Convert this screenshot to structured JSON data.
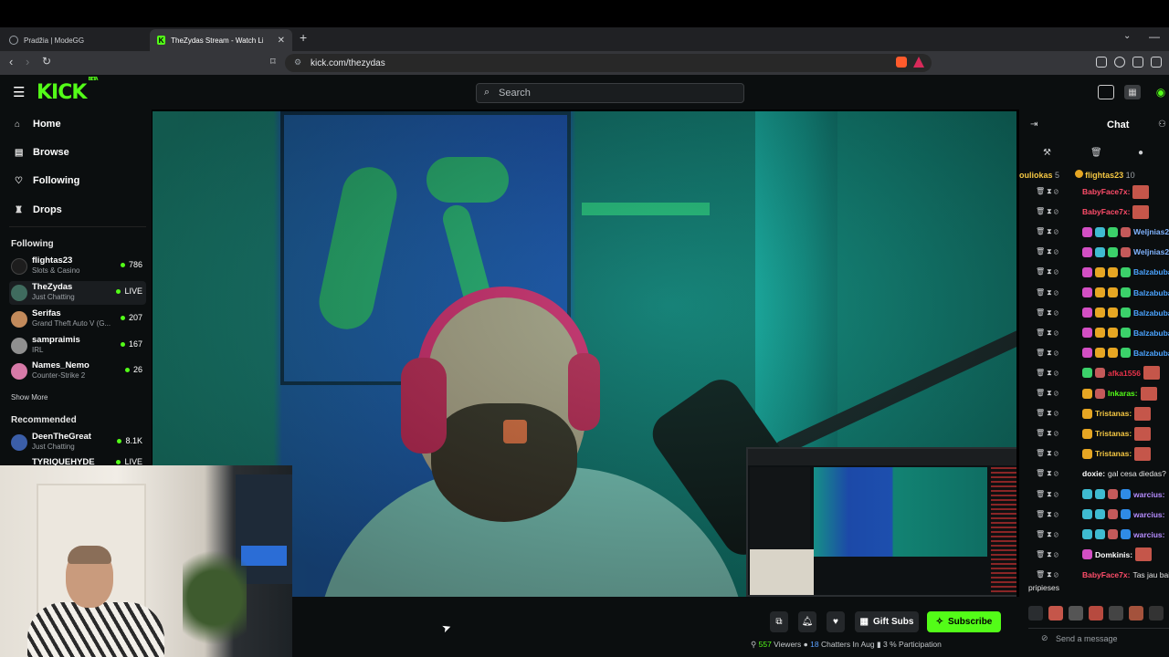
{
  "browser": {
    "tabs": [
      {
        "title": "Pradžia | ModeGG"
      },
      {
        "title": "TheZydas Stream - Watch Live o"
      }
    ],
    "url": "kick.com/thezydas"
  },
  "header": {
    "logo": "KICK",
    "logo_tag": "BETA",
    "search_placeholder": "Search"
  },
  "sidebar": {
    "nav": [
      {
        "label": "Home",
        "icon": "home-icon"
      },
      {
        "label": "Browse",
        "icon": "browse-icon"
      },
      {
        "label": "Following",
        "icon": "heart-icon"
      },
      {
        "label": "Drops",
        "icon": "drops-icon"
      }
    ],
    "following_title": "Following",
    "following": [
      {
        "name": "flightas23",
        "category": "Slots & Casino",
        "count": "786",
        "color": "#1d1d1d"
      },
      {
        "name": "TheZydas",
        "category": "Just Chatting",
        "count": "LIVE",
        "color": "#3f6b5e"
      },
      {
        "name": "Serifas",
        "category": "Grand Theft Auto V (G...",
        "count": "207",
        "color": "#c28a5b"
      },
      {
        "name": "sampraimis",
        "category": "IRL",
        "count": "167",
        "color": "#8f8f8f"
      },
      {
        "name": "Names_Nemo",
        "category": "Counter-Strike 2",
        "count": "26",
        "color": "#d77aa8"
      }
    ],
    "show_more": "Show More",
    "recommended_title": "Recommended",
    "recommended": [
      {
        "name": "DeenTheGreat",
        "category": "Just Chatting",
        "count": "8.1K",
        "color": "#3b5ea8"
      },
      {
        "name": "TYRIQUEHYDE",
        "category": "",
        "count": "LIVE",
        "color": "#555"
      }
    ]
  },
  "player": {
    "gift_subs": "Gift Subs",
    "subscribe": "Subscribe",
    "stats": {
      "viewers": "557",
      "viewers_label": "Viewers",
      "chatters": "18",
      "chatters_label": "Chatters In Aug",
      "participation": "3 %",
      "participation_label": "Participation"
    }
  },
  "chat": {
    "title": "Chat",
    "pinned": [
      {
        "user": "ouliokas",
        "count": "5"
      },
      {
        "user": "flightas23",
        "count": "10"
      }
    ],
    "messages": [
      {
        "user": "BabyFace7x:",
        "color": "#ff4d6a",
        "text": "",
        "badges": [],
        "emote": true
      },
      {
        "user": "BabyFace7x:",
        "color": "#ff4d6a",
        "text": "",
        "badges": [],
        "emote": true
      },
      {
        "user": "Weljnias2",
        "color": "#7fb3ff",
        "text": "",
        "badges": [
          "#d34fc4",
          "#3fbbd1",
          "#3bd16a",
          "#c45a5a"
        ],
        "emote": false
      },
      {
        "user": "Weljnias2",
        "color": "#7fb3ff",
        "text": "",
        "badges": [
          "#d34fc4",
          "#3fbbd1",
          "#3bd16a",
          "#c45a5a"
        ],
        "emote": false
      },
      {
        "user": "Balzabuba",
        "color": "#4aa3ff",
        "text": "",
        "badges": [
          "#d34fc4",
          "#e6a623",
          "#e6a623",
          "#3bd16a"
        ],
        "emote": false
      },
      {
        "user": "Balzabuba",
        "color": "#4aa3ff",
        "text": "",
        "badges": [
          "#d34fc4",
          "#e6a623",
          "#e6a623",
          "#3bd16a"
        ],
        "emote": false
      },
      {
        "user": "Balzabuba",
        "color": "#4aa3ff",
        "text": "",
        "badges": [
          "#d34fc4",
          "#e6a623",
          "#e6a623",
          "#3bd16a"
        ],
        "emote": false
      },
      {
        "user": "Balzabuba",
        "color": "#4aa3ff",
        "text": "",
        "badges": [
          "#d34fc4",
          "#e6a623",
          "#e6a623",
          "#3bd16a"
        ],
        "emote": false
      },
      {
        "user": "Balzabuba",
        "color": "#4aa3ff",
        "text": "",
        "badges": [
          "#d34fc4",
          "#e6a623",
          "#e6a623",
          "#3bd16a"
        ],
        "emote": false
      },
      {
        "user": "afka1556",
        "color": "#e8334a",
        "text": "",
        "badges": [
          "#3bd16a",
          "#c45a5a"
        ],
        "emote": true
      },
      {
        "user": "Inkaras:",
        "color": "#53fc18",
        "text": "",
        "badges": [
          "#e6a623",
          "#c45a5a"
        ],
        "emote": true
      },
      {
        "user": "Tristanas:",
        "color": "#f5c743",
        "text": "",
        "badges": [
          "#e6a623"
        ],
        "emote": true
      },
      {
        "user": "Tristanas:",
        "color": "#f5c743",
        "text": "",
        "badges": [
          "#e6a623"
        ],
        "emote": true
      },
      {
        "user": "Tristanas:",
        "color": "#f5c743",
        "text": "",
        "badges": [
          "#e6a623"
        ],
        "emote": true
      },
      {
        "user": "doxie:",
        "color": "#ffffff",
        "text": "gal cesa diedas?",
        "badges": [],
        "emote": false
      },
      {
        "user": "warcius:",
        "color": "#b58cff",
        "text": "",
        "badges": [
          "#3fbbd1",
          "#3fbbd1",
          "#c45a5a",
          "#2f8be6"
        ],
        "emote": false
      },
      {
        "user": "warcius:",
        "color": "#b58cff",
        "text": "",
        "badges": [
          "#3fbbd1",
          "#3fbbd1",
          "#c45a5a",
          "#2f8be6"
        ],
        "emote": false
      },
      {
        "user": "warcius:",
        "color": "#b58cff",
        "text": "",
        "badges": [
          "#3fbbd1",
          "#3fbbd1",
          "#c45a5a",
          "#2f8be6"
        ],
        "emote": false
      },
      {
        "user": "Domkinis:",
        "color": "#ffffff",
        "text": "",
        "badges": [
          "#d34fc4"
        ],
        "emote": true
      },
      {
        "user": "BabyFace7x:",
        "color": "#ff4d6a",
        "text": "Tas jau bai",
        "badges": [],
        "emote": false
      }
    ],
    "wrap_text": "pripieses",
    "send_placeholder": "Send a message"
  }
}
